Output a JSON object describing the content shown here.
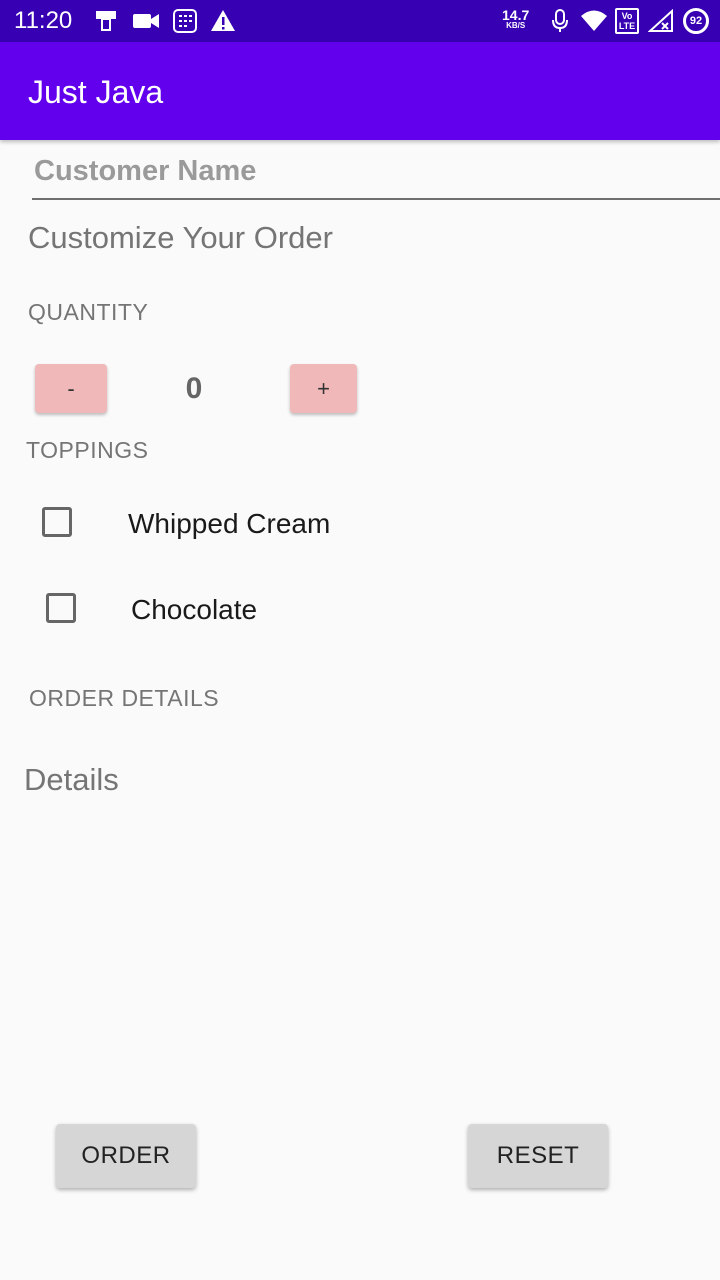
{
  "status_bar": {
    "time": "11:20",
    "network_speed": "14.7",
    "network_speed_unit": "KB/S",
    "volte_label": "Vo LTE",
    "battery_level": "92",
    "icons": [
      "phone-sync-icon",
      "video-camera-icon",
      "calculator-icon",
      "warning-icon",
      "microphone-icon",
      "wifi-icon",
      "volte-icon",
      "signal-icon",
      "battery-icon"
    ]
  },
  "app_bar": {
    "title": "Just Java",
    "color": "#6200ee",
    "status_color": "#3700b3"
  },
  "form": {
    "name_placeholder": "Customer Name",
    "name_value": "",
    "subtitle": "Customize Your Order"
  },
  "quantity": {
    "label": "QUANTITY",
    "decrement_label": "-",
    "increment_label": "+",
    "value": "0"
  },
  "toppings": {
    "label": "TOPPINGS",
    "items": [
      {
        "label": "Whipped Cream",
        "checked": false
      },
      {
        "label": "Chocolate",
        "checked": false
      }
    ]
  },
  "order_details": {
    "label": "ORDER DETAILS",
    "text": "Details"
  },
  "actions": {
    "order_label": "ORDER",
    "reset_label": "RESET"
  }
}
